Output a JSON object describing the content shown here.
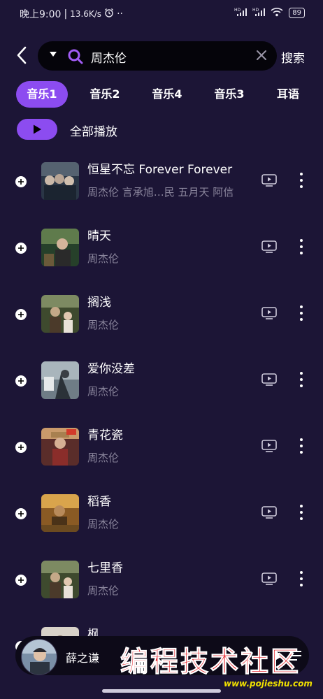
{
  "status_bar": {
    "time": "晚上9:00",
    "separator": "|",
    "speed": "13.6K/s",
    "alarm_icon": "alarm-clock-icon",
    "dots": "··",
    "signal1": "HD",
    "signal2": "HD",
    "wifi_icon": "wifi-icon",
    "battery": "89"
  },
  "search": {
    "dropdown_icon": "caret-down-icon",
    "value": "周杰伦",
    "button_label": "搜索"
  },
  "tabs": [
    {
      "label": "音乐1",
      "active": true
    },
    {
      "label": "音乐2",
      "active": false
    },
    {
      "label": "音乐4",
      "active": false
    },
    {
      "label": "音乐3",
      "active": false
    },
    {
      "label": "耳语",
      "active": false
    }
  ],
  "play_all": {
    "label": "全部播放"
  },
  "songs": [
    {
      "title": "恒星不忘 Forever Forever",
      "artist": "周杰伦 言承旭…民 五月天 阿信"
    },
    {
      "title": "晴天",
      "artist": "周杰伦"
    },
    {
      "title": "搁浅",
      "artist": "周杰伦"
    },
    {
      "title": "爱你没差",
      "artist": "周杰伦"
    },
    {
      "title": "青花瓷",
      "artist": "周杰伦"
    },
    {
      "title": "稻香",
      "artist": "周杰伦"
    },
    {
      "title": "七里香",
      "artist": "周杰伦"
    },
    {
      "title": "枫",
      "artist": ""
    }
  ],
  "player": {
    "title": "薛之谦"
  },
  "watermark": {
    "text": "编程技术社区",
    "url": "www.pojieshu.com"
  },
  "colors": {
    "accent": "#8c4cf0",
    "background": "#1c1536",
    "muted": "#8a859c",
    "watermark": "#e3151d"
  }
}
